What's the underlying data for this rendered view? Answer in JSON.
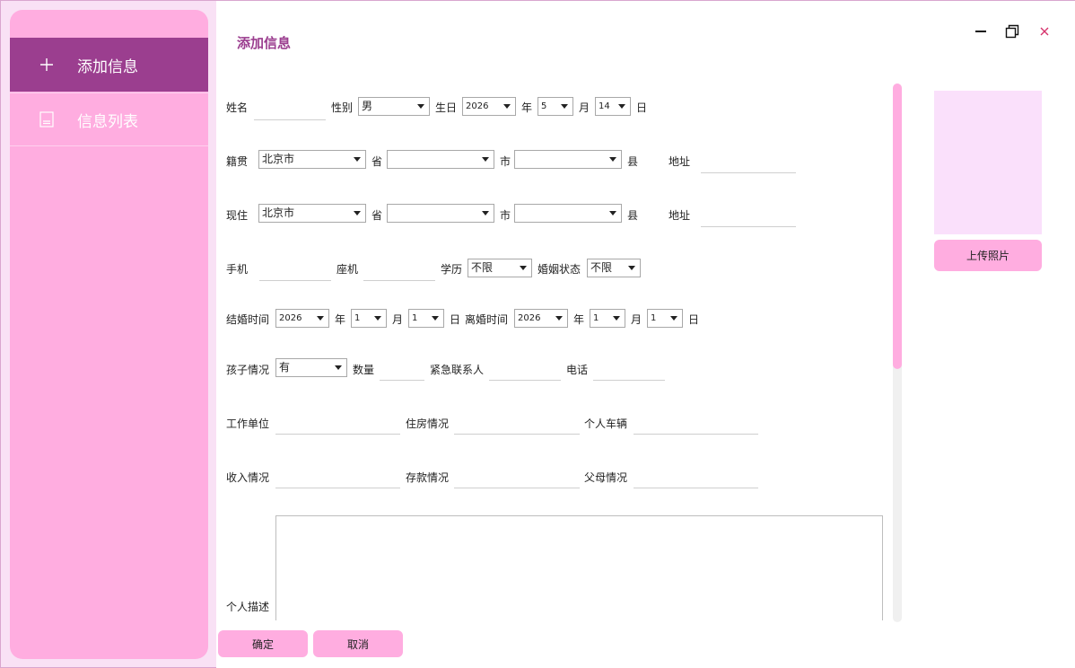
{
  "sidebar": {
    "items": [
      {
        "label": "添加信息",
        "icon": "plus-icon"
      },
      {
        "label": "信息列表",
        "icon": "list-icon"
      }
    ]
  },
  "header": {
    "title": "添加信息"
  },
  "form": {
    "row1": {
      "name_label": "姓名",
      "gender_label": "性别",
      "gender_value": "男",
      "birthday_label": "生日",
      "year_value": "2026",
      "year_unit": "年",
      "month_value": "5",
      "month_unit": "月",
      "day_value": "14",
      "day_unit": "日"
    },
    "row2": {
      "label": "籍贯",
      "province_value": "北京市",
      "province_unit": "省",
      "city_value": "",
      "city_unit": "市",
      "county_value": "",
      "county_unit": "县",
      "address_label": "地址"
    },
    "row3": {
      "label": "现住",
      "province_value": "北京市",
      "province_unit": "省",
      "city_value": "",
      "city_unit": "市",
      "county_value": "",
      "county_unit": "县",
      "address_label": "地址"
    },
    "row4": {
      "mobile_label": "手机",
      "landline_label": "座机",
      "education_label": "学历",
      "education_value": "不限",
      "marital_label": "婚姻状态",
      "marital_value": "不限"
    },
    "row5": {
      "married_label": "结婚时间",
      "married_year": "2026",
      "year_unit": "年",
      "married_month": "1",
      "month_unit": "月",
      "married_day": "1",
      "day_unit": "日",
      "divorce_label": "离婚时间",
      "divorce_year": "2026",
      "divorce_month": "1",
      "divorce_day": "1"
    },
    "row6": {
      "children_label": "孩子情况",
      "children_value": "有",
      "count_label": "数量",
      "emergency_label": "紧急联系人",
      "phone_label": "电话"
    },
    "row7": {
      "work_label": "工作单位",
      "housing_label": "住房情况",
      "vehicle_label": "个人车辆"
    },
    "row8": {
      "income_label": "收入情况",
      "savings_label": "存款情况",
      "parents_label": "父母情况"
    },
    "description_label": "个人描述"
  },
  "photo": {
    "upload_label": "上传照片"
  },
  "footer": {
    "confirm_label": "确定",
    "cancel_label": "取消"
  },
  "colors": {
    "accent": "#9b3e8f",
    "pink": "#ffade0",
    "photo_bg": "#fae0fb",
    "close": "#d6336c"
  }
}
